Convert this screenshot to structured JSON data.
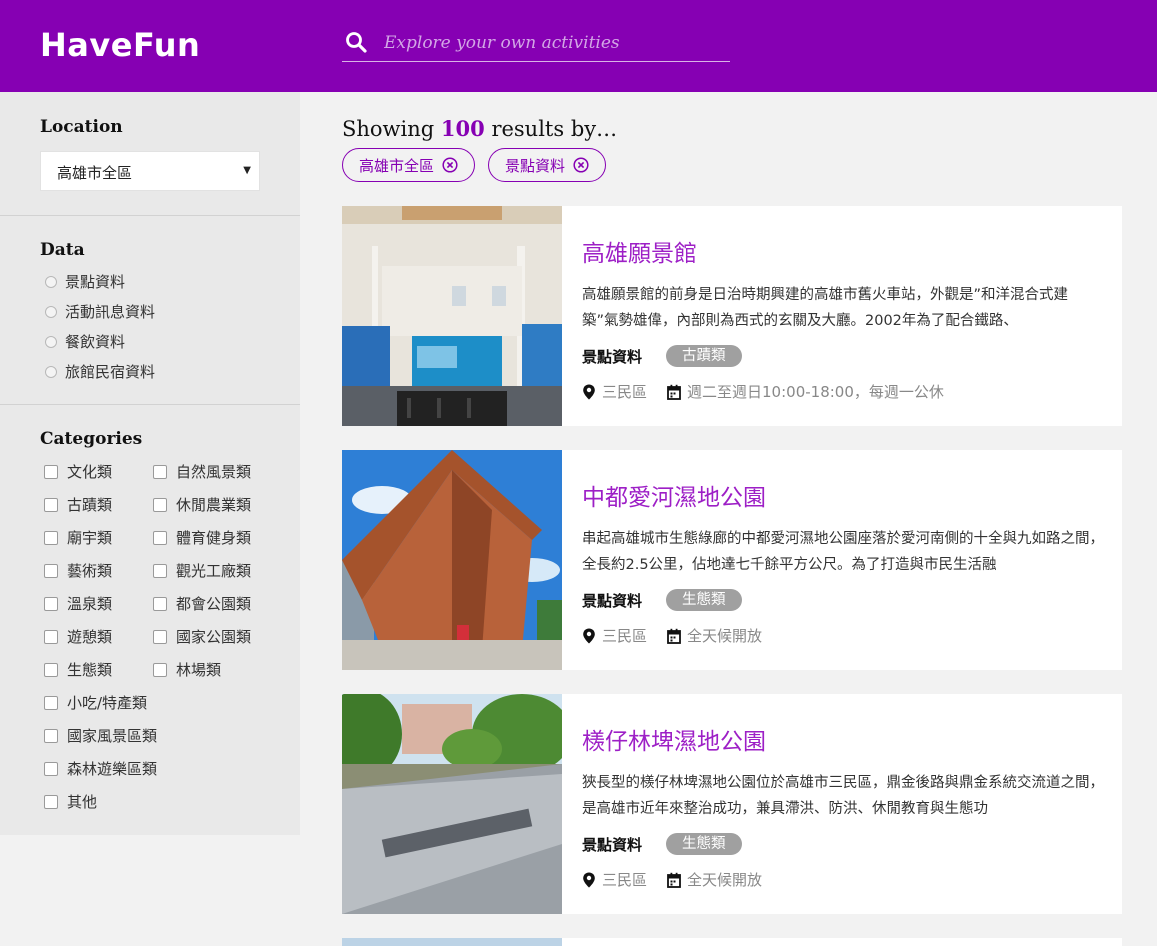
{
  "header": {
    "logo": "HaveFun",
    "search_placeholder": "Explore your own activities",
    "search_icon": "search-icon"
  },
  "sidebar": {
    "location": {
      "title": "Location",
      "selected": "高雄市全區"
    },
    "data": {
      "title": "Data",
      "options": [
        "景點資料",
        "活動訊息資料",
        "餐飲資料",
        "旅館民宿資料"
      ]
    },
    "categories": {
      "title": "Categories",
      "col1": [
        "文化類",
        "古蹟類",
        "廟宇類",
        "藝術類",
        "溫泉類",
        "遊憩類",
        "生態類",
        "小吃/特產類",
        "國家風景區類",
        "森林遊樂區類",
        "其他"
      ],
      "col2": [
        "自然風景類",
        "休閒農業類",
        "體育健身類",
        "觀光工廠類",
        "都會公園類",
        "國家公園類",
        "林場類"
      ]
    }
  },
  "results": {
    "prefix": "Showing",
    "count": "100",
    "suffix": "results by…",
    "filters": [
      "高雄市全區",
      "景點資料"
    ]
  },
  "cards": [
    {
      "title": "高雄願景館",
      "desc": "高雄願景館的前身是日治時期興建的高雄市舊火車站，外觀是”和洋混合式建築”氣勢雄偉，內部則為西式的玄關及大廳。2002年為了配合鐵路、",
      "type": "景點資料",
      "badge": "古蹟類",
      "district": "三民區",
      "hours": "週二至週日10:00-18:00，每週一公休"
    },
    {
      "title": "中都愛河濕地公園",
      "desc": "串起高雄城市生態綠廊的中都愛河濕地公園座落於愛河南側的十全與九如路之間，全長約2.5公里，佔地達七千餘平方公尺。為了打造與市民生活融",
      "type": "景點資料",
      "badge": "生態類",
      "district": "三民區",
      "hours": "全天候開放"
    },
    {
      "title": "檨仔林埤濕地公園",
      "desc": "狹長型的檨仔林埤濕地公園位於高雄市三民區，鼎金後路與鼎金系統交流道之間，是高雄市近年來整治成功，兼具滯洪、防洪、休閒教育與生態功",
      "type": "景點資料",
      "badge": "生態類",
      "district": "三民區",
      "hours": "全天候開放"
    }
  ],
  "colors": {
    "brand": "#8600b3",
    "title": "#9d1fc6",
    "badge": "#a0a0a0"
  }
}
